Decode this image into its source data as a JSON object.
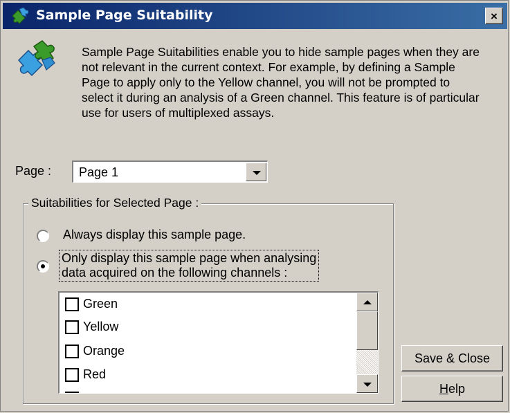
{
  "window": {
    "title": "Sample Page Suitability",
    "title_icon": "puzzle-icon",
    "close_label": "×"
  },
  "description": {
    "icon": "puzzle-icon",
    "text": "Sample Page Suitabilities enable you to hide sample pages when they are not relevant in the current context. For example, by defining a Sample Page to apply only to the Yellow channel, you will not be prompted to select it during an analysis of a Green channel. This feature is of particular use for users of multiplexed assays."
  },
  "page_selector": {
    "label": "Page :",
    "selected": "Page 1"
  },
  "suitabilities": {
    "legend": "Suitabilities for Selected Page :",
    "option_always": "Always display this sample page.",
    "option_only_line1": "Only display this sample page when analysing",
    "option_only_line2": "data acquired on the following channels :",
    "selected_option": "only",
    "channels": [
      {
        "label": "Green",
        "checked": false
      },
      {
        "label": "Yellow",
        "checked": false
      },
      {
        "label": "Orange",
        "checked": false
      },
      {
        "label": "Red",
        "checked": false
      }
    ]
  },
  "buttons": {
    "save_close": "Save & Close",
    "help": "Help"
  },
  "colors": {
    "titlebar_start": "#0a246a",
    "titlebar_end": "#3a6ea5",
    "face": "#d4d0c8"
  }
}
